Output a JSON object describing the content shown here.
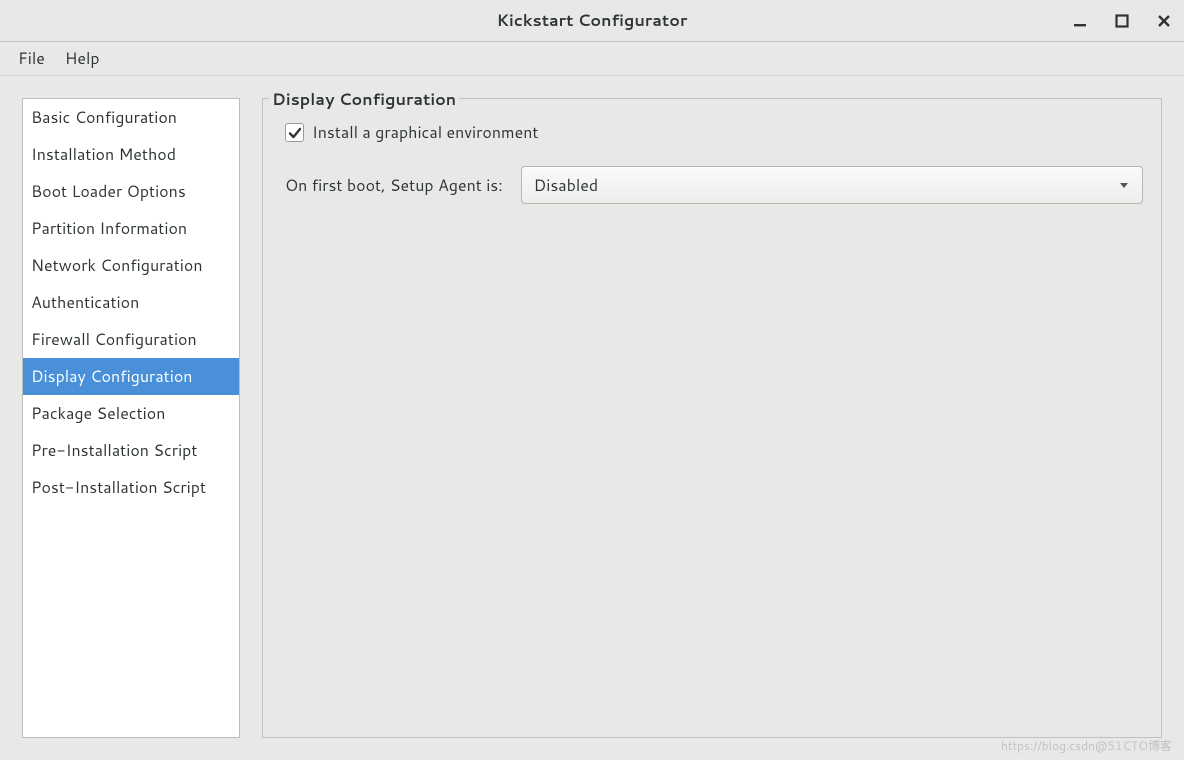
{
  "window": {
    "title": "Kickstart Configurator"
  },
  "menubar": {
    "file": "File",
    "help": "Help"
  },
  "sidebar": {
    "items": [
      {
        "label": "Basic Configuration",
        "selected": false
      },
      {
        "label": "Installation Method",
        "selected": false
      },
      {
        "label": "Boot Loader Options",
        "selected": false
      },
      {
        "label": "Partition Information",
        "selected": false
      },
      {
        "label": "Network Configuration",
        "selected": false
      },
      {
        "label": "Authentication",
        "selected": false
      },
      {
        "label": "Firewall Configuration",
        "selected": false
      },
      {
        "label": "Display Configuration",
        "selected": true
      },
      {
        "label": "Package Selection",
        "selected": false
      },
      {
        "label": "Pre-Installation Script",
        "selected": false
      },
      {
        "label": "Post-Installation Script",
        "selected": false
      }
    ]
  },
  "main": {
    "group_title": "Display Configuration",
    "install_graphical": {
      "checked": true,
      "label": "Install a graphical environment"
    },
    "setup_agent": {
      "label": "On first boot, Setup Agent is:",
      "value": "Disabled"
    }
  },
  "watermark": "https://blog.csdn@51CTO博客"
}
